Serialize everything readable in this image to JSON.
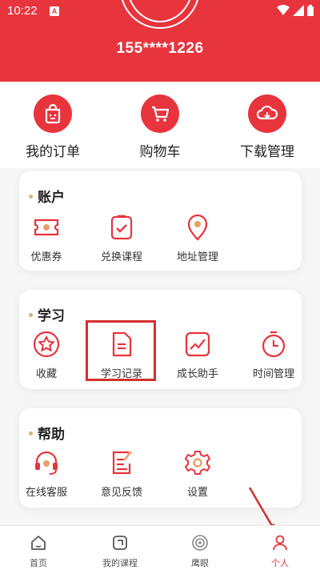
{
  "status_bar": {
    "time": "10:22",
    "indicator": "A",
    "icons": [
      "wifi-icon",
      "signal-icon",
      "battery-icon"
    ]
  },
  "profile": {
    "phone": "155****1226"
  },
  "quick_actions": [
    {
      "label": "我的订单",
      "icon": "bag-icon"
    },
    {
      "label": "购物车",
      "icon": "cart-icon"
    },
    {
      "label": "下载管理",
      "icon": "cloud-download-icon"
    }
  ],
  "sections": {
    "account": {
      "title": "账户",
      "items": [
        {
          "label": "优惠券",
          "icon": "coupon-icon"
        },
        {
          "label": "兑换课程",
          "icon": "exchange-icon"
        },
        {
          "label": "地址管理",
          "icon": "location-icon"
        }
      ]
    },
    "study": {
      "title": "学习",
      "items": [
        {
          "label": "收藏",
          "icon": "star-icon"
        },
        {
          "label": "学习记录",
          "icon": "document-icon"
        },
        {
          "label": "成长助手",
          "icon": "growth-chart-icon"
        },
        {
          "label": "时间管理",
          "icon": "timer-icon"
        }
      ]
    },
    "help": {
      "title": "帮助",
      "items": [
        {
          "label": "在线客服",
          "icon": "headset-icon"
        },
        {
          "label": "意见反馈",
          "icon": "feedback-icon"
        },
        {
          "label": "设置",
          "icon": "gear-icon"
        }
      ]
    }
  },
  "tabbar": [
    {
      "label": "首页",
      "icon": "home-icon"
    },
    {
      "label": "我的课程",
      "icon": "course-icon"
    },
    {
      "label": "鹰眼",
      "icon": "eye-icon"
    },
    {
      "label": "个人",
      "icon": "person-icon",
      "active": true
    }
  ],
  "colors": {
    "brand": "#e8343d",
    "accent_dot": "#d8b07a",
    "highlight": "#d32f2f"
  }
}
